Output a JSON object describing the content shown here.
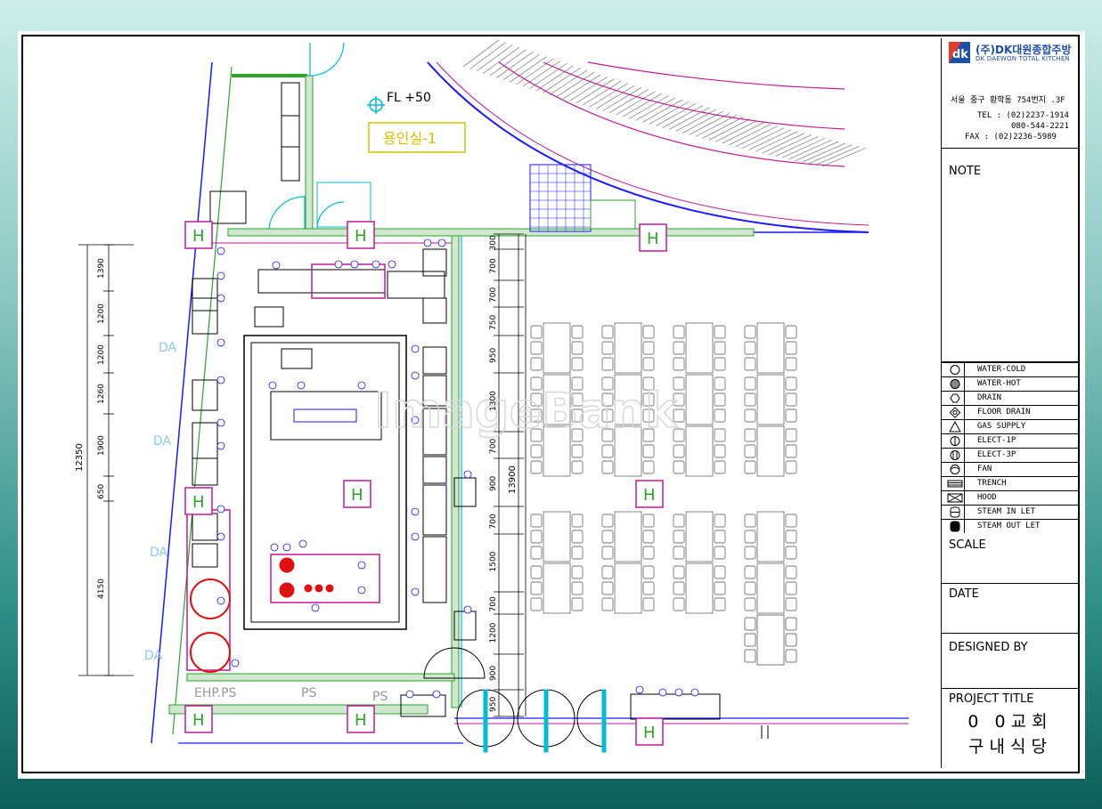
{
  "company": {
    "name_ko": "(주)DK대원종합주방",
    "name_en": "DK DAEWON TOTAL KITCHEN",
    "logo_text": "dk",
    "address": "서울 중구 황학동 754번지 .3F",
    "tel": "TEL : (02)2237-1914",
    "tel2": "080-544-2221",
    "fax": "FAX : (02)2236-5989"
  },
  "title_block": {
    "note_label": "NOTE",
    "scale_label": "SCALE",
    "date_label": "DATE",
    "designed_by_label": "DESIGNED BY",
    "project_title_label": "PROJECT TITLE",
    "project_line1": "0 0교회",
    "project_line2": "구내식당"
  },
  "legend": [
    {
      "icon": "circle-icon",
      "label": "WATER-COLD"
    },
    {
      "icon": "hatched-circle-icon",
      "label": "WATER-HOT"
    },
    {
      "icon": "drain-icon",
      "label": "DRAIN"
    },
    {
      "icon": "floor-drain-icon",
      "label": "FLOOR DRAIN"
    },
    {
      "icon": "triangle-icon",
      "label": "GAS SUPPLY"
    },
    {
      "icon": "elect-1p-icon",
      "label": "ELECT-1P"
    },
    {
      "icon": "elect-3p-icon",
      "label": "ELECT-3P"
    },
    {
      "icon": "fan-icon",
      "label": "FAN"
    },
    {
      "icon": "trench-icon",
      "label": "TRENCH"
    },
    {
      "icon": "hood-icon",
      "label": "HOOD"
    },
    {
      "icon": "steam-in-icon",
      "label": "STEAM IN LET"
    },
    {
      "icon": "steam-out-icon",
      "label": "STEAM OUT LET"
    }
  ],
  "plan": {
    "floor_level": "FL +50",
    "room_label": "용인실-1",
    "watermark": "ImageBank",
    "column_mark": "H",
    "ps_labels": [
      "EHP.PS",
      "PS",
      "PS"
    ],
    "da_label": "DA",
    "left_dims": [
      "1390",
      "1200",
      "1200",
      "1260",
      "1900",
      "650",
      "4150"
    ],
    "left_total": "12350",
    "right_dims": [
      "300",
      "700",
      "700",
      "750",
      "950",
      "1300",
      "700",
      "900",
      "700",
      "1500",
      "700",
      "1200",
      "900",
      "950"
    ],
    "right_total": "13900"
  },
  "colors": {
    "wall_green": "#2aa52a",
    "magenta": "#c2189a",
    "cyan": "#00bcd4",
    "blue": "#1a1aff",
    "red": "#e01010",
    "yellow": "#d8c000"
  }
}
